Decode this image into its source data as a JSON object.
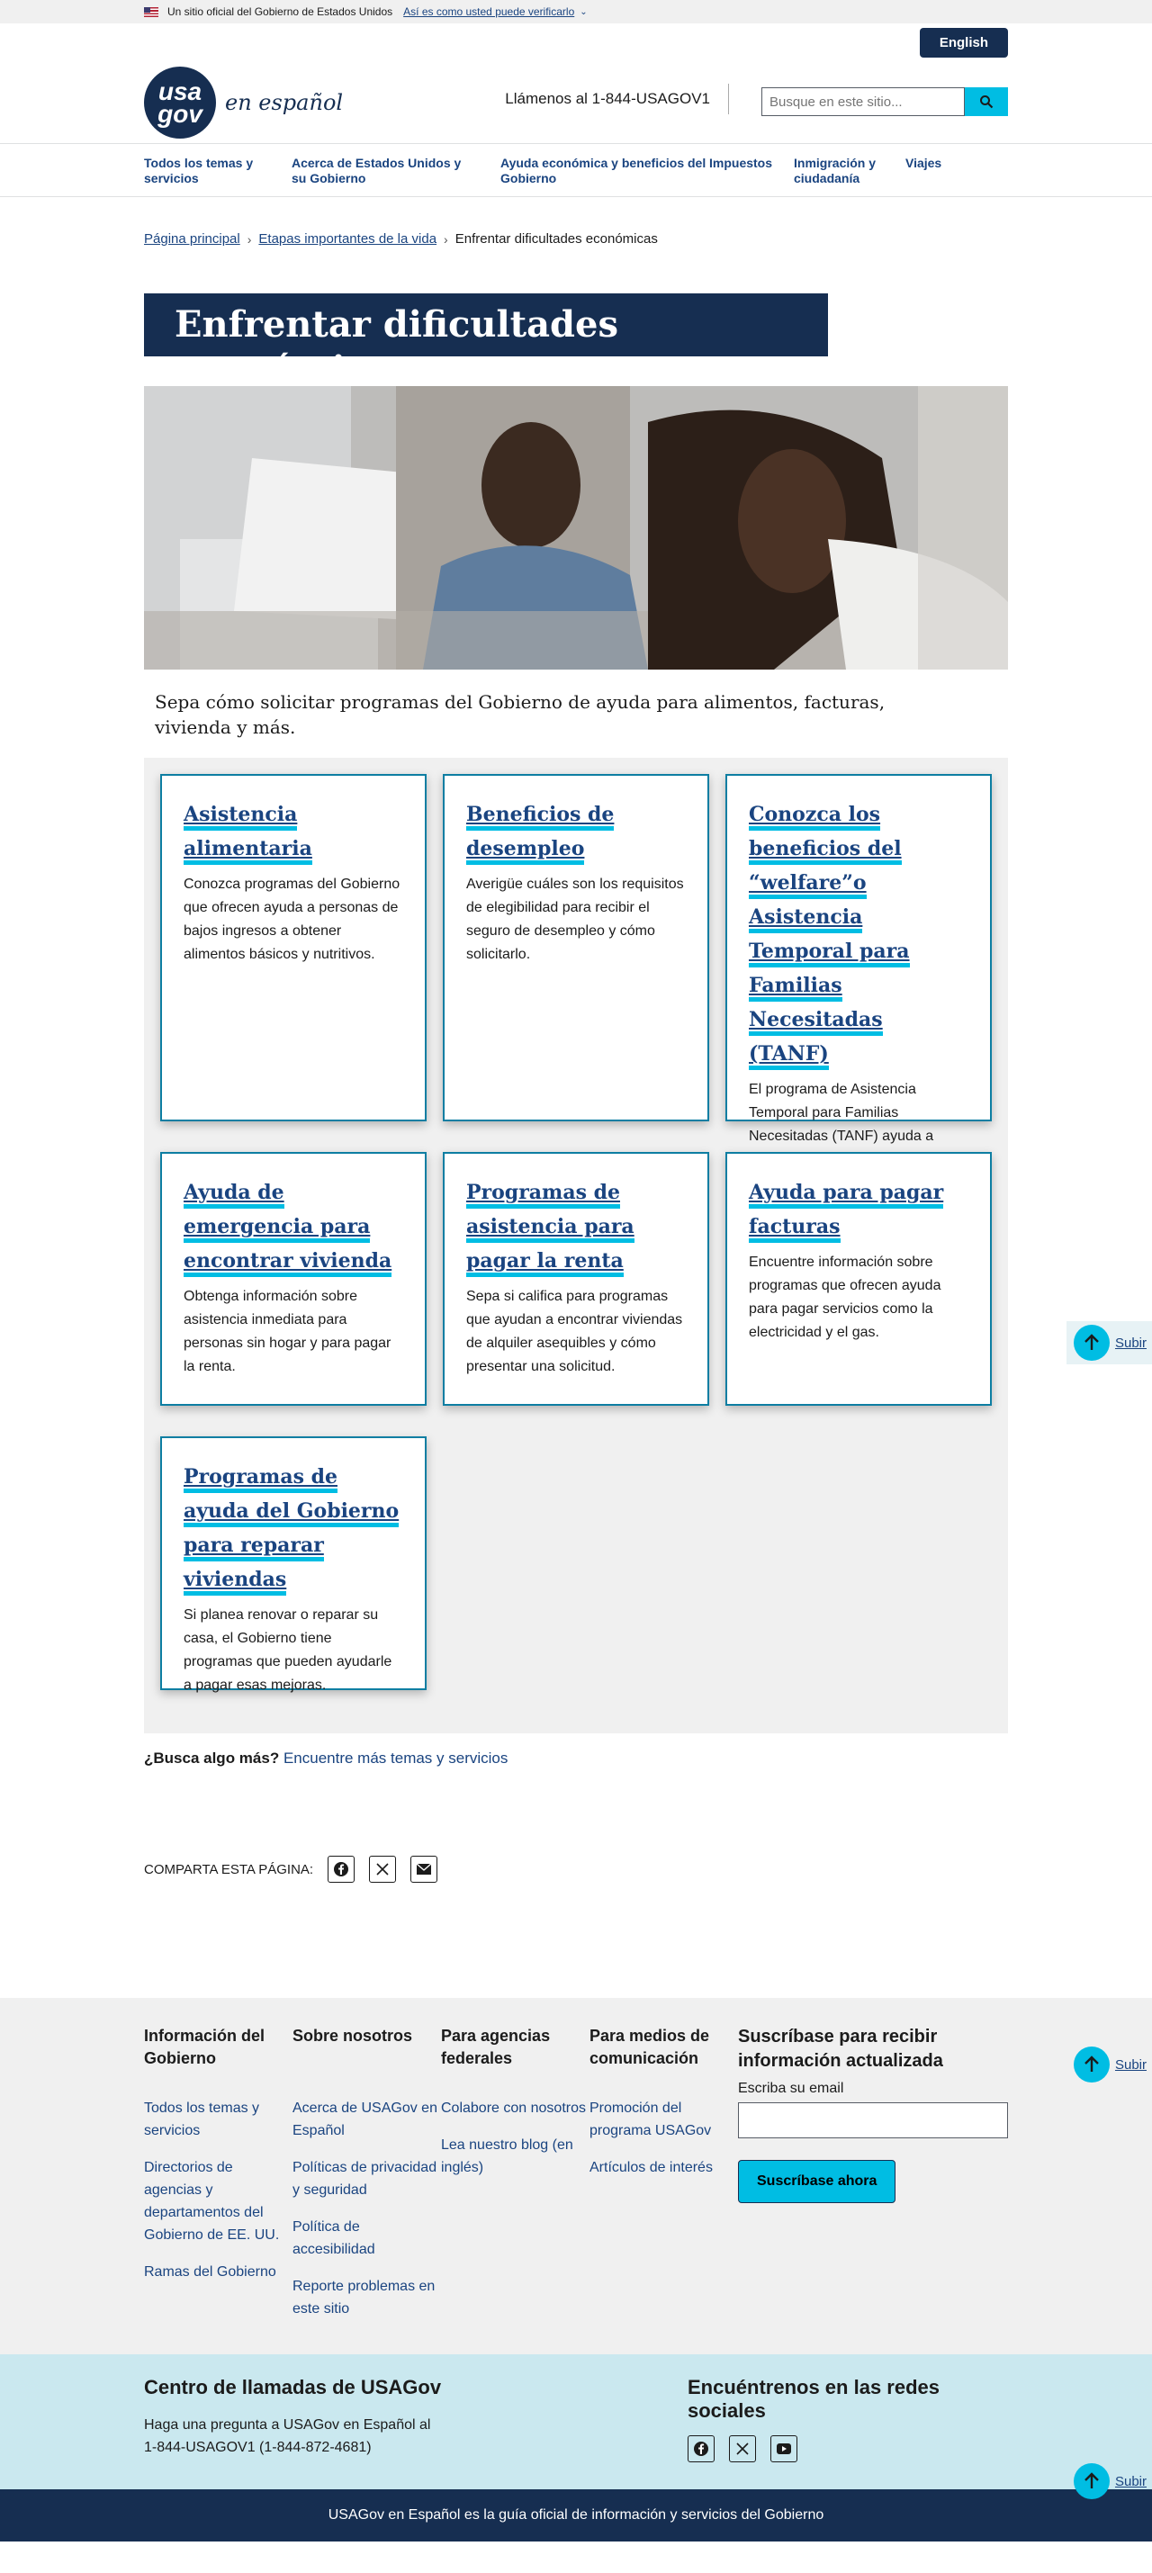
{
  "gov_banner": {
    "official_text": "Un sitio oficial del Gobierno de Estados Unidos",
    "verify_link": "Así es como usted puede verificarlo"
  },
  "header": {
    "language_button": "English",
    "logo_usa": "usa",
    "logo_gov": "gov",
    "logo_suffix": "en español",
    "phone": "Llámenos al 1-844-USAGOV1",
    "search_placeholder": "Busque en este sitio..."
  },
  "nav": {
    "items": [
      {
        "label": "Todos los temas y servicios"
      },
      {
        "label": "Acerca de Estados Unidos y su Gobierno"
      },
      {
        "label": "Ayuda económica y beneficios del Gobierno"
      },
      {
        "label": "Impuestos"
      },
      {
        "label": "Inmigración y ciudadanía"
      },
      {
        "label": "Viajes"
      }
    ]
  },
  "breadcrumb": {
    "home": "Página principal",
    "parent": "Etapas importantes de la vida",
    "current": "Enfrentar dificultades económicas"
  },
  "page": {
    "title": "Enfrentar dificultades económicas",
    "lede": "Sepa cómo solicitar programas del Gobierno de ayuda para alimentos, facturas, vivienda y más."
  },
  "cards": [
    {
      "title": "Asistencia alimentaria",
      "body": "Conozca programas del Gobierno que ofrecen ayuda a personas de bajos ingresos a obtener alimentos básicos y nutritivos."
    },
    {
      "title": "Beneficios de desempleo",
      "body": "Averigüe cuáles son los requisitos de elegibilidad para recibir el seguro de desempleo y cómo solicitarlo."
    },
    {
      "title": "Conozca los beneficios del “welfare”o Asistencia Temporal para Familias Necesitadas (TANF)",
      "body": "El programa de Asistencia Temporal para Familias Necesitadas (TANF) ayuda a familias con dificultades económicas."
    },
    {
      "title": "Ayuda de emergencia para encontrar vivienda",
      "body": "Obtenga información sobre asistencia inmediata para personas sin hogar y para pagar la renta."
    },
    {
      "title": "Programas de asistencia para pagar la renta",
      "body": "Sepa si califica para programas que ayudan a encontrar viviendas de alquiler asequibles y cómo presentar una solicitud."
    },
    {
      "title": "Ayuda para pagar facturas",
      "body": "Encuentre información sobre programas que ofrecen ayuda para pagar servicios como la electricidad y el gas."
    },
    {
      "title": "Programas de ayuda del Gobierno para reparar viviendas",
      "body": "Si planea renovar o reparar su casa, el Gobierno tiene programas que pueden ayudarle a pagar esas mejoras."
    }
  ],
  "more": {
    "question": "¿Busca algo más?",
    "link": "Encuentre más temas y servicios"
  },
  "share": {
    "label": "COMPARTA ESTA PÁGINA:"
  },
  "back_to_top": "Subir",
  "footer": {
    "columns": [
      {
        "heading": "Información del Gobierno",
        "links": [
          "Todos los temas y servicios",
          "Directorios de agencias y departamentos del Gobierno de EE. UU.",
          "Ramas del Gobierno"
        ]
      },
      {
        "heading": "Sobre nosotros",
        "links": [
          "Acerca de USAGov en Español",
          "Políticas de privacidad y seguridad",
          "Política de accesibilidad",
          "Reporte problemas en este sitio"
        ]
      },
      {
        "heading": "Para agencias federales",
        "links": [
          "Colabore con nosotros",
          "Lea nuestro blog (en inglés)"
        ]
      },
      {
        "heading": "Para medios de comunicación",
        "links": [
          "Promoción del programa USAGov",
          "Artículos de interés"
        ]
      }
    ],
    "subscribe": {
      "heading": "Suscríbase para recibir información actualizada",
      "email_label": "Escriba su email",
      "button": "Suscríbase ahora"
    }
  },
  "call_center": {
    "heading": "Centro de llamadas de USAGov",
    "line1": "Haga una pregunta a USAGov en Español al",
    "line2": "1-844-USAGOV1 (1-844-872-4681)"
  },
  "social": {
    "heading": "Encuéntrenos en las redes sociales"
  },
  "bottom_bar": "USAGov en Español es la guía oficial de información y servicios del Gobierno"
}
